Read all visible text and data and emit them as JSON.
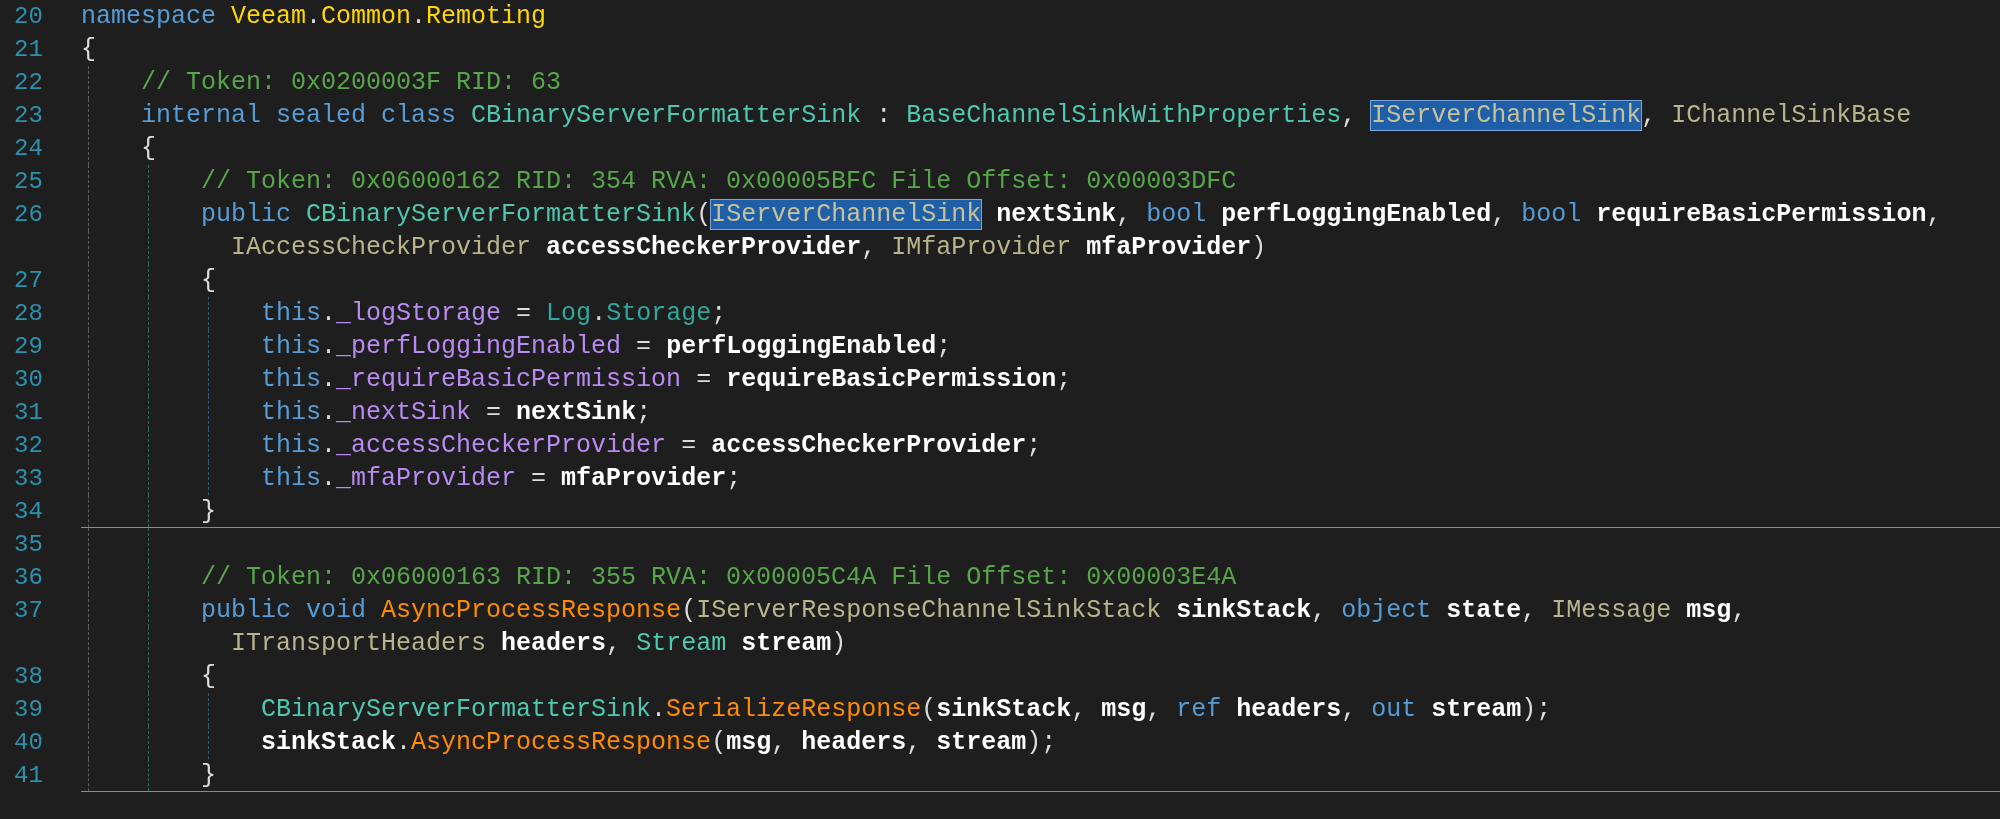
{
  "editor": {
    "lines": [
      {
        "number": "20",
        "separator": false,
        "tokens": [
          {
            "text": "namespace ",
            "kind": "keyword"
          },
          {
            "text": "Veeam",
            "kind": "namespace"
          },
          {
            "text": ".",
            "kind": "plain"
          },
          {
            "text": "Common",
            "kind": "namespace"
          },
          {
            "text": ".",
            "kind": "plain"
          },
          {
            "text": "Remoting",
            "kind": "namespace"
          }
        ]
      },
      {
        "number": "21",
        "separator": false,
        "tokens": [
          {
            "text": "{",
            "kind": "plain"
          }
        ]
      },
      {
        "number": "22",
        "separator": false,
        "tokens": [
          {
            "text": "    // Token: 0x0200003F RID: 63",
            "kind": "comment"
          }
        ]
      },
      {
        "number": "23",
        "separator": false,
        "tokens": [
          {
            "text": "    internal sealed class ",
            "kind": "keyword"
          },
          {
            "text": "CBinaryServerFormatterSink",
            "kind": "type"
          },
          {
            "text": " : ",
            "kind": "plain"
          },
          {
            "text": "BaseChannelSinkWithProperties",
            "kind": "type"
          },
          {
            "text": ", ",
            "kind": "plain"
          },
          {
            "text": "IServerChannelSink",
            "kind": "match"
          },
          {
            "text": ", ",
            "kind": "plain"
          },
          {
            "text": "IChannelSinkBase",
            "kind": "interface"
          }
        ]
      },
      {
        "number": "24",
        "separator": false,
        "tokens": [
          {
            "text": "    {",
            "kind": "plain"
          }
        ]
      },
      {
        "number": "25",
        "separator": false,
        "tokens": [
          {
            "text": "        // Token: 0x06000162 RID: 354 RVA: 0x00005BFC File Offset: 0x00003DFC",
            "kind": "comment"
          }
        ]
      },
      {
        "number": "26",
        "separator": false,
        "tokens": [
          {
            "text": "        public ",
            "kind": "keyword"
          },
          {
            "text": "CBinaryServerFormatterSink",
            "kind": "type"
          },
          {
            "text": "(",
            "kind": "plain"
          },
          {
            "text": "IServerChannelSink",
            "kind": "match"
          },
          {
            "text": " nextSink",
            "kind": "param"
          },
          {
            "text": ", ",
            "kind": "plain"
          },
          {
            "text": "bool ",
            "kind": "keyword"
          },
          {
            "text": "perfLoggingEnabled",
            "kind": "param"
          },
          {
            "text": ", ",
            "kind": "plain"
          },
          {
            "text": "bool ",
            "kind": "keyword"
          },
          {
            "text": "requireBasicPermission",
            "kind": "param"
          },
          {
            "text": ",",
            "kind": "plain"
          }
        ],
        "wrap_tokens": [
          {
            "text": "          IAccessCheckProvider ",
            "kind": "interface"
          },
          {
            "text": "accessCheckerProvider",
            "kind": "param"
          },
          {
            "text": ", ",
            "kind": "plain"
          },
          {
            "text": "IMfaProvider ",
            "kind": "interface"
          },
          {
            "text": "mfaProvider",
            "kind": "param"
          },
          {
            "text": ")",
            "kind": "plain"
          }
        ]
      },
      {
        "number": "27",
        "separator": false,
        "tokens": [
          {
            "text": "        {",
            "kind": "plain"
          }
        ]
      },
      {
        "number": "28",
        "separator": false,
        "tokens": [
          {
            "text": "            this",
            "kind": "keyword"
          },
          {
            "text": ".",
            "kind": "plain"
          },
          {
            "text": "_logStorage",
            "kind": "field"
          },
          {
            "text": " = ",
            "kind": "plain"
          },
          {
            "text": "Log",
            "kind": "static"
          },
          {
            "text": ".",
            "kind": "plain"
          },
          {
            "text": "Storage",
            "kind": "static"
          },
          {
            "text": ";",
            "kind": "plain"
          }
        ]
      },
      {
        "number": "29",
        "separator": false,
        "tokens": [
          {
            "text": "            this",
            "kind": "keyword"
          },
          {
            "text": ".",
            "kind": "plain"
          },
          {
            "text": "_perfLoggingEnabled",
            "kind": "field"
          },
          {
            "text": " = ",
            "kind": "plain"
          },
          {
            "text": "perfLoggingEnabled",
            "kind": "param"
          },
          {
            "text": ";",
            "kind": "plain"
          }
        ]
      },
      {
        "number": "30",
        "separator": false,
        "tokens": [
          {
            "text": "            this",
            "kind": "keyword"
          },
          {
            "text": ".",
            "kind": "plain"
          },
          {
            "text": "_requireBasicPermission",
            "kind": "field"
          },
          {
            "text": " = ",
            "kind": "plain"
          },
          {
            "text": "requireBasicPermission",
            "kind": "param"
          },
          {
            "text": ";",
            "kind": "plain"
          }
        ]
      },
      {
        "number": "31",
        "separator": false,
        "tokens": [
          {
            "text": "            this",
            "kind": "keyword"
          },
          {
            "text": ".",
            "kind": "plain"
          },
          {
            "text": "_nextSink",
            "kind": "field"
          },
          {
            "text": " = ",
            "kind": "plain"
          },
          {
            "text": "nextSink",
            "kind": "param"
          },
          {
            "text": ";",
            "kind": "plain"
          }
        ]
      },
      {
        "number": "32",
        "separator": false,
        "tokens": [
          {
            "text": "            this",
            "kind": "keyword"
          },
          {
            "text": ".",
            "kind": "plain"
          },
          {
            "text": "_accessCheckerProvider",
            "kind": "field"
          },
          {
            "text": " = ",
            "kind": "plain"
          },
          {
            "text": "accessCheckerProvider",
            "kind": "param"
          },
          {
            "text": ";",
            "kind": "plain"
          }
        ]
      },
      {
        "number": "33",
        "separator": false,
        "tokens": [
          {
            "text": "            this",
            "kind": "keyword"
          },
          {
            "text": ".",
            "kind": "plain"
          },
          {
            "text": "_mfaProvider",
            "kind": "field"
          },
          {
            "text": " = ",
            "kind": "plain"
          },
          {
            "text": "mfaProvider",
            "kind": "param"
          },
          {
            "text": ";",
            "kind": "plain"
          }
        ]
      },
      {
        "number": "34",
        "separator": true,
        "tokens": [
          {
            "text": "        }",
            "kind": "plain"
          }
        ]
      },
      {
        "number": "35",
        "separator": false
      },
      {
        "number": "36",
        "separator": false,
        "tokens": [
          {
            "text": "        // Token: 0x06000163 RID: 355 RVA: 0x00005C4A File Offset: 0x00003E4A",
            "kind": "comment"
          }
        ]
      },
      {
        "number": "37",
        "separator": false,
        "tokens": [
          {
            "text": "        public void ",
            "kind": "keyword"
          },
          {
            "text": "AsyncProcessResponse",
            "kind": "method"
          },
          {
            "text": "(",
            "kind": "plain"
          },
          {
            "text": "IServerResponseChannelSinkStack ",
            "kind": "interface"
          },
          {
            "text": "sinkStack",
            "kind": "param"
          },
          {
            "text": ", ",
            "kind": "plain"
          },
          {
            "text": "object ",
            "kind": "keyword"
          },
          {
            "text": "state",
            "kind": "param"
          },
          {
            "text": ", ",
            "kind": "plain"
          },
          {
            "text": "IMessage ",
            "kind": "interface"
          },
          {
            "text": "msg",
            "kind": "param"
          },
          {
            "text": ",",
            "kind": "plain"
          }
        ],
        "wrap_tokens": [
          {
            "text": "          ITransportHeaders ",
            "kind": "interface"
          },
          {
            "text": "headers",
            "kind": "param"
          },
          {
            "text": ", ",
            "kind": "plain"
          },
          {
            "text": "Stream ",
            "kind": "type"
          },
          {
            "text": "stream",
            "kind": "param"
          },
          {
            "text": ")",
            "kind": "plain"
          }
        ]
      },
      {
        "number": "38",
        "separator": false,
        "tokens": [
          {
            "text": "        {",
            "kind": "plain"
          }
        ]
      },
      {
        "number": "39",
        "separator": false,
        "tokens": [
          {
            "text": "            CBinaryServerFormatterSink",
            "kind": "type"
          },
          {
            "text": ".",
            "kind": "plain"
          },
          {
            "text": "SerializeResponse",
            "kind": "method"
          },
          {
            "text": "(",
            "kind": "plain"
          },
          {
            "text": "sinkStack",
            "kind": "param"
          },
          {
            "text": ", ",
            "kind": "plain"
          },
          {
            "text": "msg",
            "kind": "param"
          },
          {
            "text": ", ",
            "kind": "plain"
          },
          {
            "text": "ref ",
            "kind": "keyword"
          },
          {
            "text": "headers",
            "kind": "param"
          },
          {
            "text": ", ",
            "kind": "plain"
          },
          {
            "text": "out ",
            "kind": "keyword"
          },
          {
            "text": "stream",
            "kind": "param"
          },
          {
            "text": ");",
            "kind": "plain"
          }
        ]
      },
      {
        "number": "40",
        "separator": false,
        "tokens": [
          {
            "text": "            sinkStack",
            "kind": "param"
          },
          {
            "text": ".",
            "kind": "plain"
          },
          {
            "text": "AsyncProcessResponse",
            "kind": "method"
          },
          {
            "text": "(",
            "kind": "plain"
          },
          {
            "text": "msg",
            "kind": "param"
          },
          {
            "text": ", ",
            "kind": "plain"
          },
          {
            "text": "headers",
            "kind": "param"
          },
          {
            "text": ", ",
            "kind": "plain"
          },
          {
            "text": "stream",
            "kind": "param"
          },
          {
            "text": ");",
            "kind": "plain"
          }
        ]
      },
      {
        "number": "41",
        "separator": true,
        "tokens": [
          {
            "text": "        }",
            "kind": "plain"
          }
        ]
      }
    ]
  }
}
